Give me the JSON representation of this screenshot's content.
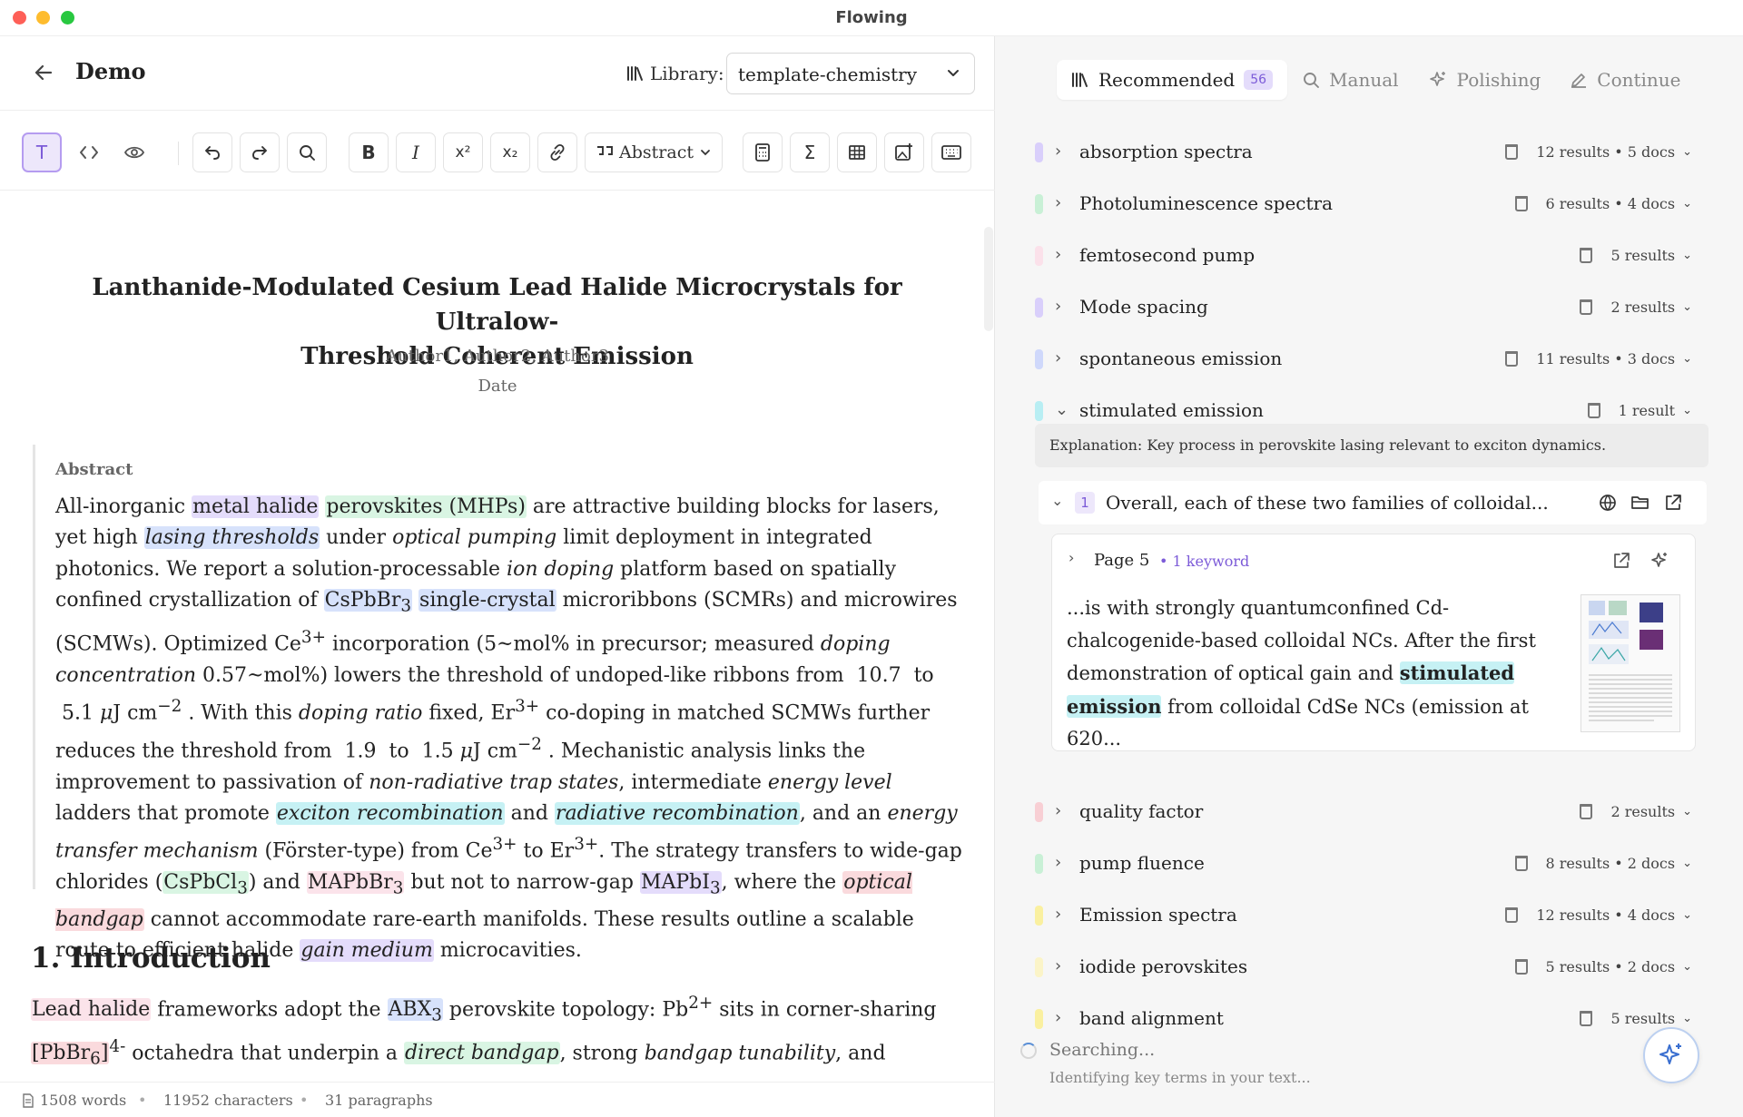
{
  "window": {
    "title": "Flowing"
  },
  "header": {
    "doc_title": "Demo",
    "library_label": "Library:",
    "library_value": "template-chemistry"
  },
  "toolbar": {
    "format_block_label": "Abstract"
  },
  "paper": {
    "title_line1": "Lanthanide-Modulated Cesium Lead Halide Microcrystals for Ultralow-",
    "title_line2": "Threshold Coherent Emission",
    "authors": "Author1, Author2, Author3",
    "date": "Date",
    "abstract_heading": "Abstract",
    "intro_heading": "1. Introduction"
  },
  "footer": {
    "words": "1508 words",
    "characters": "11952 characters",
    "paragraphs": "31 paragraphs"
  },
  "panel": {
    "tabs": [
      {
        "label": "Recommended",
        "badge": "56"
      },
      {
        "label": "Manual"
      },
      {
        "label": "Polishing"
      },
      {
        "label": "Continue"
      }
    ],
    "keywords": [
      {
        "label": "absorption spectra",
        "meta": "12 results • 5 docs",
        "color": "#d9cffb"
      },
      {
        "label": "Photoluminescence spectra",
        "meta": "6 results • 4 docs",
        "color": "#c9f0d6"
      },
      {
        "label": "femtosecond pump",
        "meta": "5 results",
        "color": "#fbe1ea"
      },
      {
        "label": "Mode spacing",
        "meta": "2 results",
        "color": "#d9cffb"
      },
      {
        "label": "spontaneous emission",
        "meta": "11 results • 3 docs",
        "color": "#cfd8fb"
      },
      {
        "label": "stimulated emission",
        "meta": "1 result",
        "color": "#b8eef3"
      },
      {
        "label": "quality factor",
        "meta": "2 results",
        "color": "#f8cfd4"
      },
      {
        "label": "pump fluence",
        "meta": "8 results • 2 docs",
        "color": "#c9f0d6"
      },
      {
        "label": "Emission spectra",
        "meta": "12 results • 4 docs",
        "color": "#faf0a0"
      },
      {
        "label": "iodide perovskites",
        "meta": "5 results • 2 docs",
        "color": "#fbf4c8"
      },
      {
        "label": "band alignment",
        "meta": "5 results",
        "color": "#faf0a0"
      }
    ],
    "explanation": "Explanation: Key process in perovskite lasing relevant to exciton dynamics.",
    "result": {
      "number": "1",
      "title": "Overall, each of these two families of colloidal...",
      "page_label": "Page 5",
      "page_keywords": "• 1 keyword",
      "snippet_before": "...is with strongly quantumconfined Cd-chalcogenide-based colloidal NCs. After the first demonstration of optical gain and ",
      "snippet_highlight_1": "stimulated",
      "snippet_highlight_2": "emission",
      "snippet_after": " from colloidal CdSe NCs (emission at 620..."
    },
    "status": {
      "searching": "Searching...",
      "identifying": "Identifying key terms in your text..."
    }
  }
}
